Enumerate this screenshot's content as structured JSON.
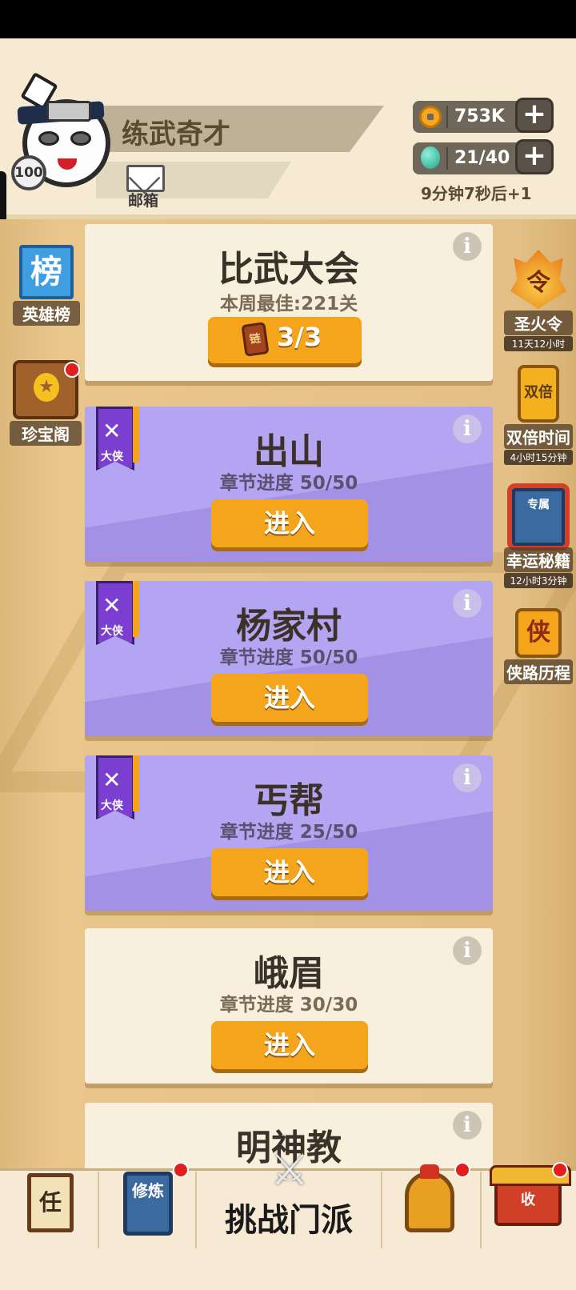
{
  "header": {
    "player_name": "练武奇才",
    "level": "100",
    "mail_label": "邮箱",
    "coins": "753K",
    "energy": "21/40",
    "regen_text": "9分钟7秒后+1",
    "plus_symbol": "+"
  },
  "left_sidebar": [
    {
      "icon": "rank-scroll-icon",
      "icon_text": "榜",
      "label": "英雄榜"
    },
    {
      "icon": "treasure-chest-icon",
      "label": "珍宝阁",
      "has_notification": true
    }
  ],
  "right_sidebar": [
    {
      "icon": "fire-token-icon",
      "icon_text": "令",
      "label": "圣火令",
      "timer": "11天12小时"
    },
    {
      "icon": "double-card-icon",
      "icon_text": "双倍",
      "label": "双倍时间",
      "timer": "4小时15分钟"
    },
    {
      "icon": "secret-book-icon",
      "icon_text": "专属",
      "label": "幸运秘籍",
      "timer": "12小时3分钟"
    },
    {
      "icon": "xia-badge-icon",
      "icon_text": "侠",
      "label": "侠路历程"
    }
  ],
  "tournament": {
    "title": "比武大会",
    "best": "本周最佳:221关",
    "ticket_icon_text": "链",
    "count": "3/3",
    "info": "i"
  },
  "hero_badge": {
    "text": "大侠",
    "cross": "✕"
  },
  "chapters": [
    {
      "title": "出山",
      "progress": "章节进度 50/50",
      "button": "进入",
      "style": "purple",
      "badge": true
    },
    {
      "title": "杨家村",
      "progress": "章节进度 50/50",
      "button": "进入",
      "style": "purple",
      "badge": true
    },
    {
      "title": "丐帮",
      "progress": "章节进度 25/50",
      "button": "进入",
      "style": "purple",
      "badge": true
    },
    {
      "title": "峨眉",
      "progress": "章节进度 30/30",
      "button": "进入",
      "style": "tan",
      "badge": false
    },
    {
      "title": "明神教",
      "progress": "",
      "button": "",
      "style": "tan",
      "badge": false
    }
  ],
  "bottom_nav": {
    "task_icon_text": "任",
    "cultivate_icon_text": "修炼",
    "swords_icon": "⚔",
    "challenge_label": "挑战门派",
    "collect_icon_text": "收"
  },
  "colors": {
    "accent_orange": "#f5a51c",
    "card_purple": "#a391e6",
    "card_tan": "#f8efdc",
    "notification_red": "#e41e1e"
  }
}
